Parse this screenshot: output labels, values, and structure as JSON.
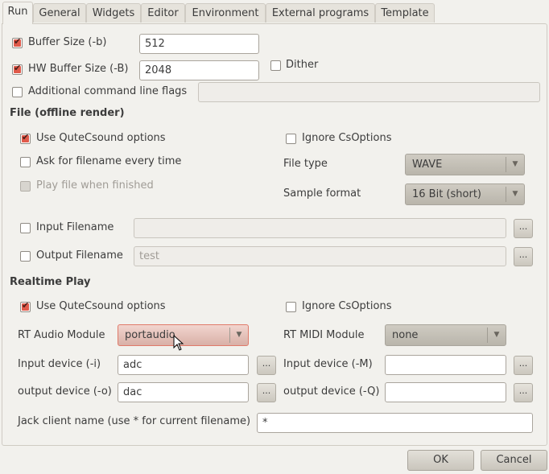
{
  "tabs": [
    "Run",
    "General",
    "Widgets",
    "Editor",
    "Environment",
    "External programs",
    "Template"
  ],
  "buffer": {
    "label": "Buffer Size (-b)",
    "checked": true,
    "value": "512"
  },
  "hw_buffer": {
    "label": "HW Buffer Size (-B)",
    "checked": true,
    "value": "2048"
  },
  "dither": {
    "label": "Dither",
    "checked": false
  },
  "additional_flags": {
    "label": "Additional command line flags",
    "checked": false,
    "value": ""
  },
  "file": {
    "heading": "File (offline render)",
    "use_options": "Use QuteCsound options",
    "ignore_options": "Ignore CsOptions",
    "ask_filename": "Ask for filename every time",
    "play_when_finished": "Play file when finished",
    "file_type_label": "File type",
    "file_type": "WAVE",
    "sample_format_label": "Sample format",
    "sample_format": "16 Bit (short)",
    "input_filename": "Input Filename",
    "input_value": "",
    "output_filename": "Output Filename",
    "output_value": "test"
  },
  "realtime": {
    "heading": "Realtime Play",
    "use_options": "Use QuteCsound options",
    "ignore_options": "Ignore CsOptions",
    "rt_audio_label": "RT Audio Module",
    "rt_audio": "portaudio",
    "rt_midi_label": "RT MIDI Module",
    "rt_midi": "none",
    "input_device_label": "Input device (-i)",
    "input_device": "adc",
    "output_device_label": "output device (-o)",
    "output_device": "dac",
    "midi_in_label": "Input device (-M)",
    "midi_in": "",
    "midi_out_label": "output device (-Q)",
    "midi_out": "",
    "jack_label": "Jack client name (use * for current filename)",
    "jack_value": "*"
  },
  "browse": "...",
  "dropdown_arrow": "▼",
  "buttons": {
    "ok": "OK",
    "cancel": "Cancel"
  },
  "accent": "#e05a4a"
}
